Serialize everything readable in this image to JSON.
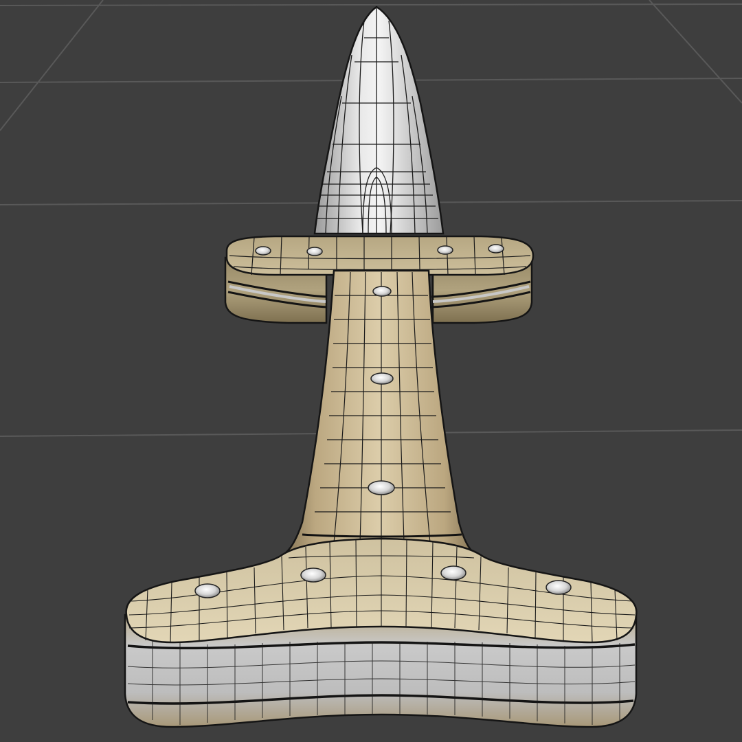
{
  "viewport": {
    "kind": "3D modeling viewport - wireframe-on-shaded",
    "background_color": "#3e3e3e",
    "grid_color": "#5a5a5a",
    "wire_color": "#141414"
  },
  "model": {
    "subject": "dagger",
    "blade_color": "#cfcfcf",
    "bone_color": "#d8c8a0",
    "bone_shadow_color": "#8f7f5e",
    "rivet_color": "#e4e4e4",
    "band_color": "#bdbdbd"
  }
}
